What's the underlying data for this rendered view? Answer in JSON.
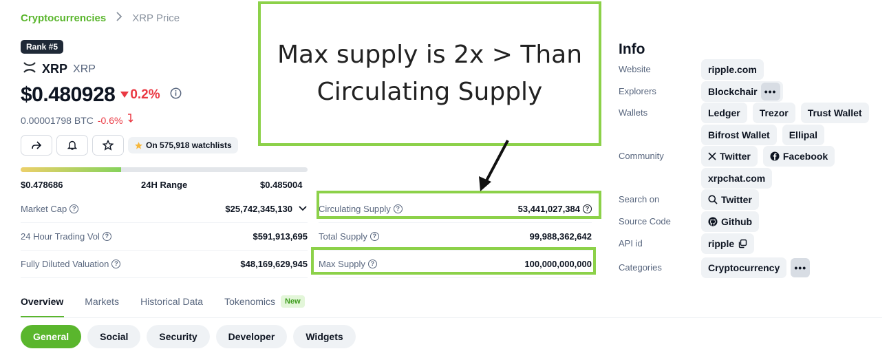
{
  "breadcrumb": {
    "root": "Cryptocurrencies",
    "separator": ">",
    "current": "XRP Price"
  },
  "coin": {
    "rank": "Rank #5",
    "name": "XRP",
    "symbol": "XRP",
    "price": "$0.480928",
    "change_24h": "0.2%",
    "btc_price": "0.00001798 BTC",
    "btc_change": "-0.6%",
    "watchlists": "On 575,918 watchlists"
  },
  "range": {
    "low": "$0.478686",
    "label": "24H Range",
    "high": "$0.485004",
    "position": 0.35
  },
  "stats_left": [
    {
      "label": "Market Cap",
      "value": "$25,742,345,130"
    },
    {
      "label": "24 Hour Trading Vol",
      "value": "$591,913,695"
    },
    {
      "label": "Fully Diluted Valuation",
      "value": "$48,169,629,945"
    }
  ],
  "stats_right": [
    {
      "label": "Circulating Supply",
      "value": "53,441,027,384"
    },
    {
      "label": "Total Supply",
      "value": "99,988,362,642"
    },
    {
      "label": "Max Supply",
      "value": "100,000,000,000"
    }
  ],
  "callout": {
    "line1": "Max supply is 2x > Than",
    "line2": "Circulating Supply"
  },
  "info": {
    "title": "Info",
    "website_label": "Website",
    "website": "ripple.com",
    "explorers_label": "Explorers",
    "explorer": "Blockchair",
    "wallets_label": "Wallets",
    "wallets": [
      "Ledger",
      "Trezor",
      "Trust Wallet",
      "Bifrost Wallet",
      "Ellipal"
    ],
    "community_label": "Community",
    "community": [
      "Twitter",
      "Facebook",
      "xrpchat.com"
    ],
    "search_label": "Search on",
    "search": "Twitter",
    "source_label": "Source Code",
    "source": "Github",
    "api_label": "API id",
    "api": "ripple",
    "categories_label": "Categories",
    "category": "Cryptocurrency",
    "more": "•••"
  },
  "tabs": [
    "Overview",
    "Markets",
    "Historical Data",
    "Tokenomics"
  ],
  "tab_badge": "New",
  "pills": [
    "General",
    "Social",
    "Security",
    "Developer",
    "Widgets"
  ],
  "colors": {
    "accent_green": "#5ab62d",
    "down_red": "#ea3943",
    "highlight_box": "#8cd149"
  }
}
